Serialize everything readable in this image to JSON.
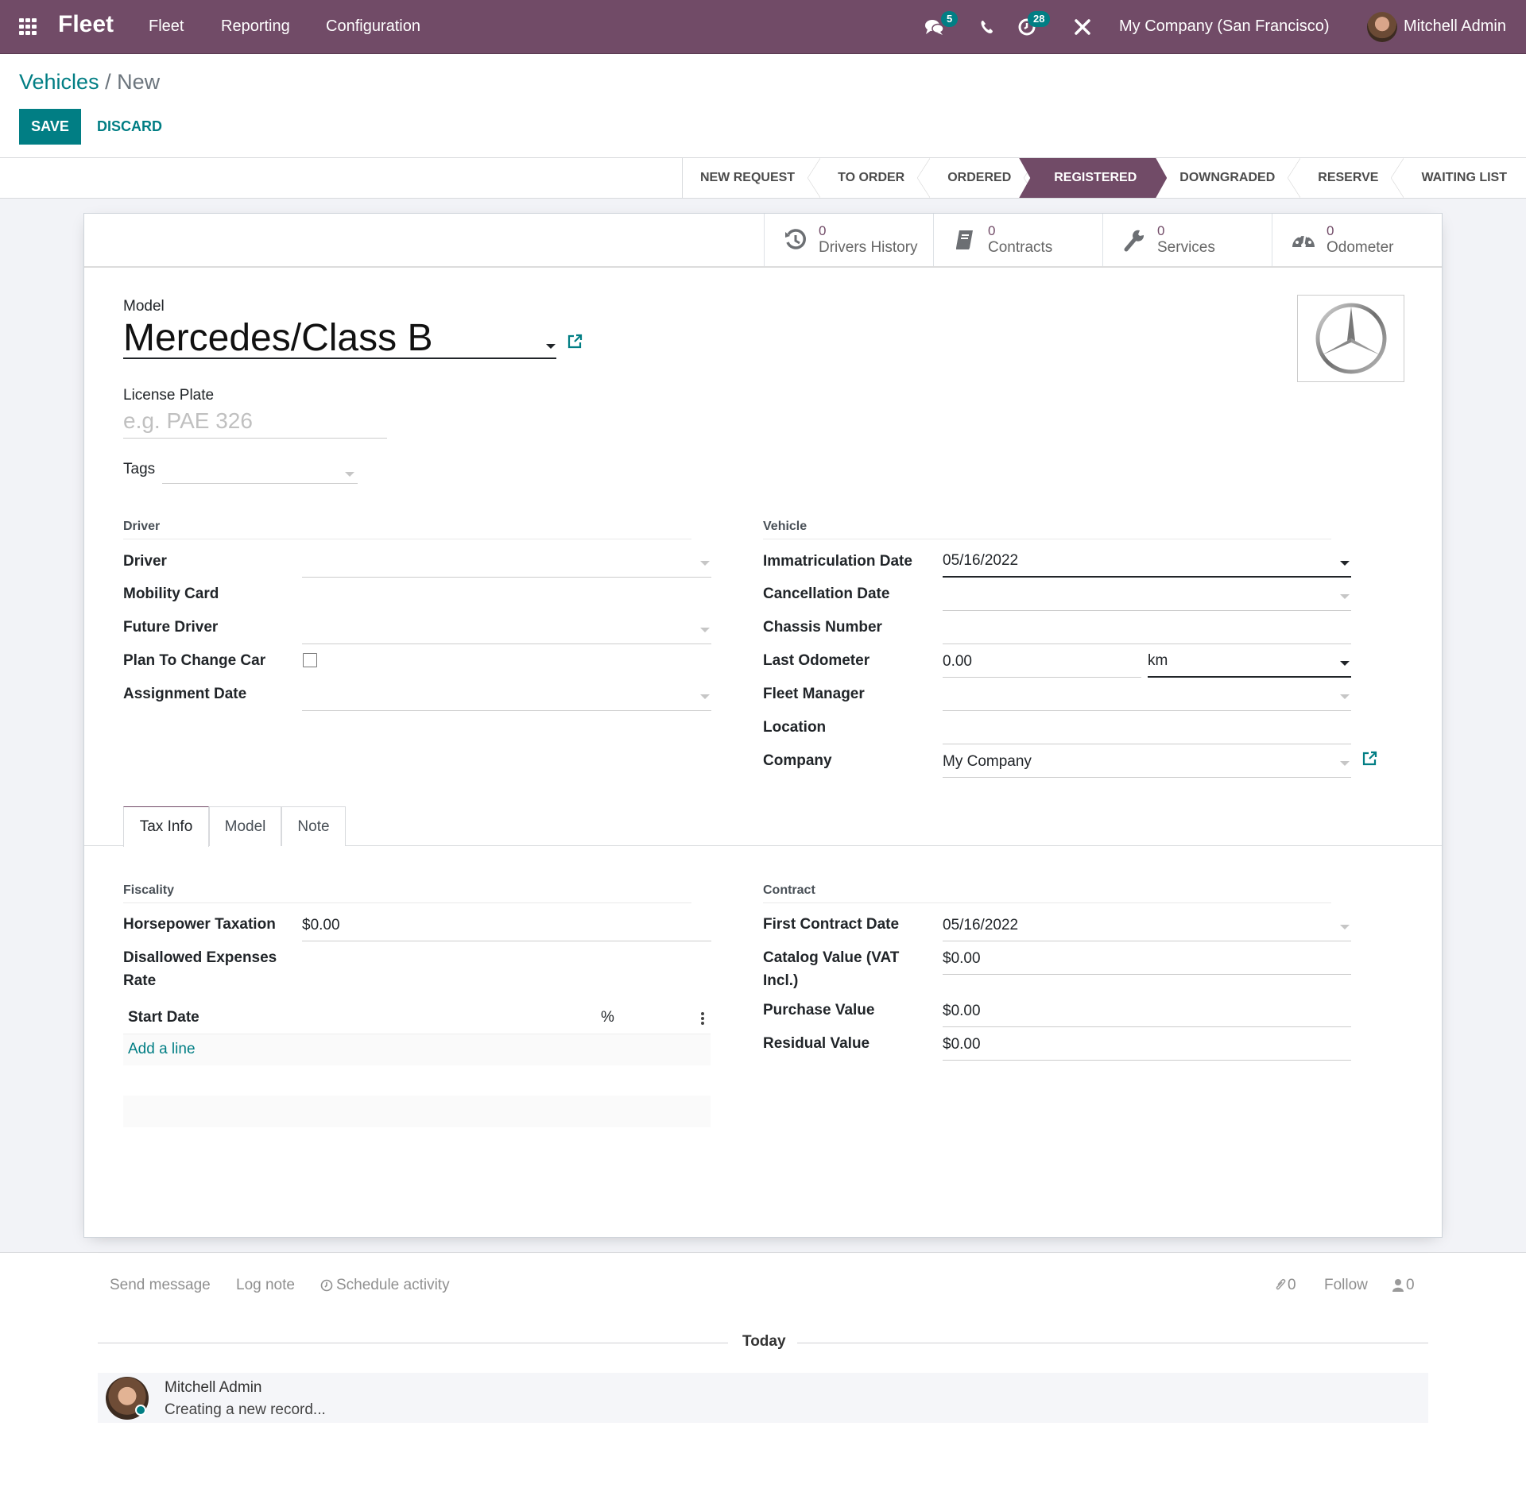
{
  "navbar": {
    "brand": "Fleet",
    "menu": [
      "Fleet",
      "Reporting",
      "Configuration"
    ],
    "messages_badge": "5",
    "activities_badge": "28",
    "company": "My Company (San Francisco)",
    "user": "Mitchell Admin",
    "accent_color": "#714B67",
    "badge_color": "#017e84"
  },
  "breadcrumb": {
    "parent": "Vehicles",
    "separator": "/",
    "current": "New"
  },
  "actions": {
    "save": "SAVE",
    "discard": "DISCARD"
  },
  "statusbar": {
    "stages": [
      "NEW REQUEST",
      "TO ORDER",
      "ORDERED",
      "REGISTERED",
      "DOWNGRADED",
      "RESERVE",
      "WAITING LIST"
    ],
    "active": "REGISTERED"
  },
  "stat_buttons": [
    {
      "icon": "history-icon",
      "value": "0",
      "label": "Drivers History"
    },
    {
      "icon": "book-icon",
      "value": "0",
      "label": "Contracts"
    },
    {
      "icon": "wrench-icon",
      "value": "0",
      "label": "Services"
    },
    {
      "icon": "tachometer-icon",
      "value": "0",
      "label": "Odometer"
    }
  ],
  "header": {
    "model_label": "Model",
    "model_value": "Mercedes/Class B",
    "plate_label": "License Plate",
    "plate_placeholder": "e.g. PAE 326",
    "tags_label": "Tags",
    "image_alt": "mercedes-logo"
  },
  "driver_group": {
    "title": "Driver",
    "fields": [
      {
        "label": "Driver",
        "value": ""
      },
      {
        "label": "Mobility Card",
        "value": ""
      },
      {
        "label": "Future Driver",
        "value": ""
      },
      {
        "label": "Plan To Change Car",
        "checked": false
      },
      {
        "label": "Assignment Date",
        "value": ""
      }
    ]
  },
  "vehicle_group": {
    "title": "Vehicle",
    "fields": [
      {
        "label": "Immatriculation Date",
        "value": "05/16/2022"
      },
      {
        "label": "Cancellation Date",
        "value": ""
      },
      {
        "label": "Chassis Number",
        "value": ""
      },
      {
        "label": "Last Odometer",
        "value": "0.00",
        "unit": "km"
      },
      {
        "label": "Fleet Manager",
        "value": ""
      },
      {
        "label": "Location",
        "value": ""
      },
      {
        "label": "Company",
        "value": "My Company"
      }
    ]
  },
  "notebook": {
    "tabs": [
      "Tax Info",
      "Model",
      "Note"
    ],
    "active": "Tax Info"
  },
  "fiscality": {
    "title": "Fiscality",
    "horsepower_label": "Horsepower Taxation",
    "horsepower_value": "$0.00",
    "disallowed_label": "Disallowed Expenses Rate",
    "columns": [
      "Start Date",
      "%"
    ],
    "add_line": "Add a line"
  },
  "contract": {
    "title": "Contract",
    "fields": [
      {
        "label": "First Contract Date",
        "value": "05/16/2022"
      },
      {
        "label": "Catalog Value (VAT Incl.)",
        "value": "$0.00"
      },
      {
        "label": "Purchase Value",
        "value": "$0.00"
      },
      {
        "label": "Residual Value",
        "value": "$0.00"
      }
    ]
  },
  "chatter": {
    "send_message": "Send message",
    "log_note": "Log note",
    "schedule_activity": "Schedule activity",
    "attachments_count": "0",
    "follow": "Follow",
    "followers_count": "0",
    "date_separator": "Today",
    "messages": [
      {
        "author": "Mitchell Admin",
        "body": "Creating a new record..."
      }
    ]
  }
}
